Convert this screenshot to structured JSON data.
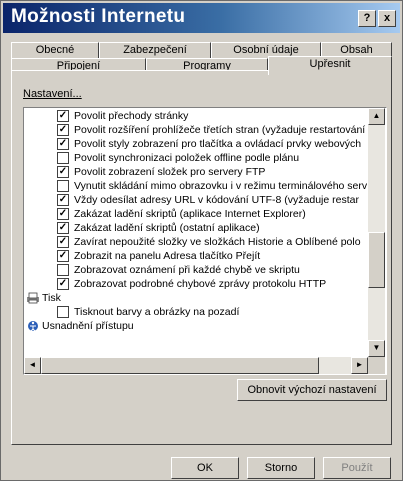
{
  "window": {
    "title": "Možnosti Internetu",
    "help_label": "?",
    "close_label": "x"
  },
  "tabs_back": [
    "Obecné",
    "Zabezpečení",
    "Osobní údaje",
    "Obsah"
  ],
  "tabs_front": [
    "Připojení",
    "Programy",
    "Upřesnit"
  ],
  "active_tab": "Upřesnit",
  "settings_label": "Nastavení...",
  "settings": [
    {
      "text": "Povolit přechody stránky",
      "checked": true
    },
    {
      "text": "Povolit rozšíření prohlížeče třetích stran (vyžaduje restartování",
      "checked": true
    },
    {
      "text": "Povolit styly zobrazení pro tlačítka a ovládací prvky webových",
      "checked": true
    },
    {
      "text": "Povolit synchronizaci položek offline podle plánu",
      "checked": false
    },
    {
      "text": "Povolit zobrazení složek pro servery FTP",
      "checked": true
    },
    {
      "text": "Vynutit skládání mimo obrazovku i v režimu terminálového serv",
      "checked": false
    },
    {
      "text": "Vždy odesílat adresy URL v kódování UTF-8 (vyžaduje restar",
      "checked": true
    },
    {
      "text": "Zakázat ladění skriptů (aplikace Internet Explorer)",
      "checked": true
    },
    {
      "text": "Zakázat ladění skriptů (ostatní aplikace)",
      "checked": true
    },
    {
      "text": "Zavírat nepoužité složky ve složkách Historie a Oblíbené polo",
      "checked": true
    },
    {
      "text": "Zobrazit na panelu Adresa tlačítko Přejít",
      "checked": true
    },
    {
      "text": "Zobrazovat oznámení při každé chybě ve skriptu",
      "checked": false
    },
    {
      "text": "Zobrazovat podrobné chybové zprávy protokolu HTTP",
      "checked": true
    }
  ],
  "group_print": "Tisk",
  "print_setting": {
    "text": "Tisknout barvy a obrázky na pozadí",
    "checked": false
  },
  "group_access": "Usnadnění přístupu",
  "buttons": {
    "restore": "Obnovit výchozí nastavení",
    "ok": "OK",
    "cancel": "Storno",
    "apply": "Použít"
  },
  "scroll": {
    "up": "▲",
    "down": "▼",
    "left": "◄",
    "right": "►"
  }
}
